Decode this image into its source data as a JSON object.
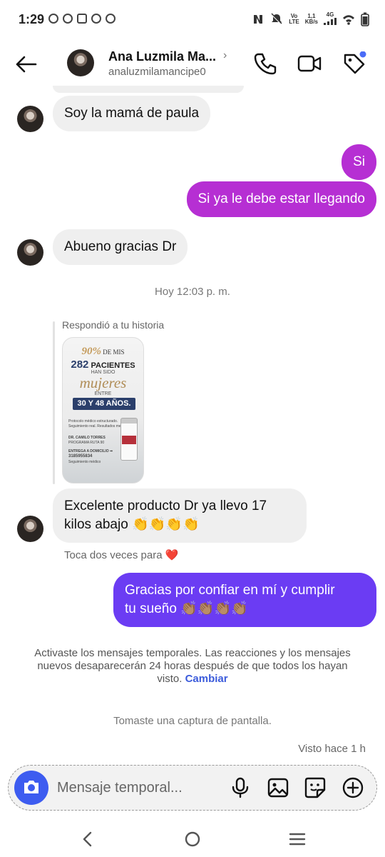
{
  "status_bar": {
    "time": "1:29",
    "net_top": "1,1",
    "net_bottom": "KB/s",
    "lte_top": "Vo",
    "lte_bottom": "LTE",
    "gen": "4G"
  },
  "header": {
    "name": "Ana Luzmila Ma...",
    "username": "analuzmilamancipe0",
    "chevron": "›"
  },
  "messages": [
    {
      "text": "Soy la mamá de paula"
    },
    {
      "text": "Si"
    },
    {
      "text": "Si ya le debe estar llegando"
    },
    {
      "text": "Abueno gracias Dr"
    }
  ],
  "timestamp": "Hoy 12:03 p. m.",
  "story_reply": {
    "label": "Respondió a tu historia",
    "card": {
      "pct": "90%",
      "de_mis": "DE MIS",
      "num": "282",
      "pacientes": "PACIENTES",
      "han_sido": "HAN SIDO",
      "mujeres": "mujeres",
      "entre": "ENTRE",
      "range": "30 Y 48 AÑOS.",
      "line1": "Protocolo médico estructurado.",
      "line2": "Seguimiento real. Resultados medibles.",
      "doctor": "DR. CAMILO TORRES",
      "program": "PROGRAMA RUTA 90",
      "delivery": "ENTREGA A DOMICILIO ➡",
      "phone": "3185955834",
      "follow": "Seguimiento médico"
    }
  },
  "reply_message": {
    "line1": "Excelente producto Dr ya llevo 17",
    "line2": "kilos abajo 👏👏👏👏"
  },
  "double_tap_hint": "Toca dos veces para ❤️",
  "sent_message": {
    "line1": "Gracias por confiar en mí y cumplir",
    "line2": "tu sueño 👏🏽👏🏽👏🏽👏🏽"
  },
  "notice": {
    "text": "Activaste los mensajes temporales. Las reacciones y los mensajes nuevos desaparecerán 24 horas después de que todos los hayan visto.",
    "link": "Cambiar"
  },
  "screenshot_notice": "Tomaste una captura de pantalla.",
  "seen": "Visto hace 1 h",
  "composer": {
    "placeholder": "Mensaje temporal..."
  },
  "colors": {
    "outgoing": "#b62fd3",
    "outgoing_last": "#6b3cf3",
    "camera": "#3d5cf0",
    "link": "#3b5bdb"
  },
  "icons": [
    "back-arrow-icon",
    "phone-icon",
    "video-camera-icon",
    "tag-icon",
    "camera-icon",
    "microphone-icon",
    "gallery-icon",
    "sticker-icon",
    "plus-circle-icon"
  ]
}
